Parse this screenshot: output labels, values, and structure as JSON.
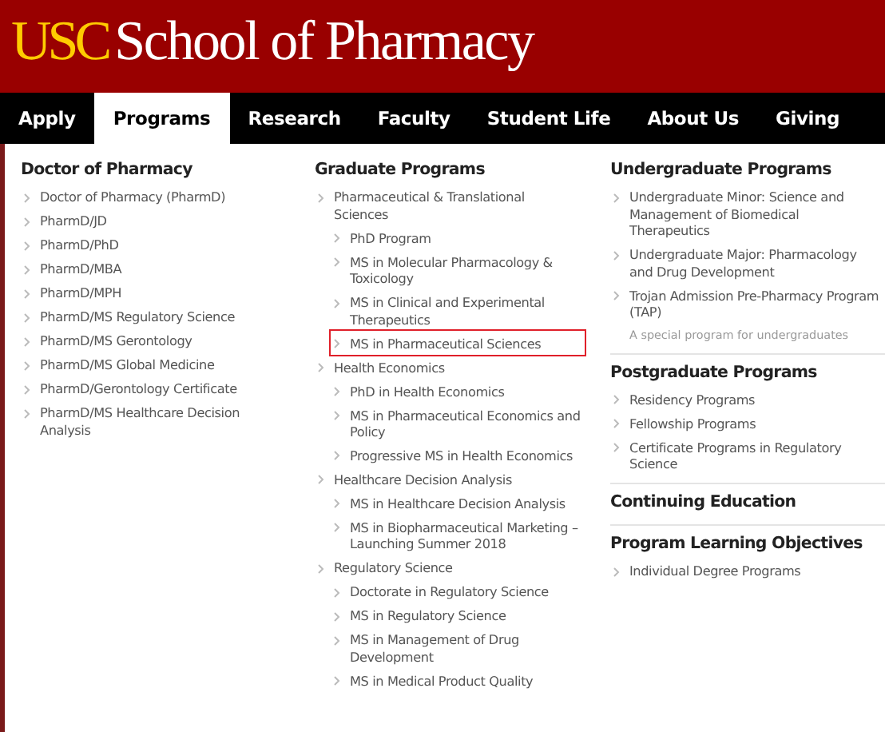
{
  "header": {
    "logo_mark": "USC",
    "title": "School of Pharmacy"
  },
  "nav": [
    {
      "label": "Apply",
      "selected": false
    },
    {
      "label": "Programs",
      "selected": true
    },
    {
      "label": "Research",
      "selected": false
    },
    {
      "label": "Faculty",
      "selected": false
    },
    {
      "label": "Student Life",
      "selected": false
    },
    {
      "label": "About Us",
      "selected": false
    },
    {
      "label": "Giving",
      "selected": false
    }
  ],
  "columns": [
    {
      "sections": [
        {
          "heading": "Doctor of Pharmacy",
          "items": [
            {
              "label": "Doctor of Pharmacy (PharmD)"
            },
            {
              "label": "PharmD/JD"
            },
            {
              "label": "PharmD/PhD"
            },
            {
              "label": "PharmD/MBA"
            },
            {
              "label": "PharmD/MPH"
            },
            {
              "label": "PharmD/MS Regulatory Science"
            },
            {
              "label": "PharmD/MS Gerontology"
            },
            {
              "label": "PharmD/MS Global Medicine"
            },
            {
              "label": "PharmD/Gerontology Certificate"
            },
            {
              "label": "PharmD/MS Healthcare Decision Analysis"
            }
          ]
        }
      ]
    },
    {
      "sections": [
        {
          "heading": "Graduate Programs",
          "items": [
            {
              "label": "Pharmaceutical & Translational Sciences",
              "children": [
                {
                  "label": "PhD Program",
                  "highlighted": false
                },
                {
                  "label": "MS in Molecular Pharmacology & Toxicology",
                  "highlighted": false
                },
                {
                  "label": "MS in Clinical and Experimental Therapeutics",
                  "highlighted": false
                },
                {
                  "label": "MS in Pharmaceutical Sciences",
                  "highlighted": true
                }
              ]
            },
            {
              "label": "Health Economics",
              "children": [
                {
                  "label": "PhD in Health Economics",
                  "highlighted": false
                },
                {
                  "label": "MS in Pharmaceutical Economics and Policy",
                  "highlighted": false
                },
                {
                  "label": "Progressive MS in Health Economics",
                  "highlighted": false
                }
              ]
            },
            {
              "label": "Healthcare Decision Analysis",
              "children": [
                {
                  "label": "MS in Healthcare Decision Analysis",
                  "highlighted": false
                },
                {
                  "label": "MS in Biopharmaceutical Marketing – Launching Summer 2018",
                  "highlighted": false
                }
              ]
            },
            {
              "label": "Regulatory Science",
              "children": [
                {
                  "label": "Doctorate in Regulatory Science",
                  "highlighted": false
                },
                {
                  "label": "MS in Regulatory Science",
                  "highlighted": false
                },
                {
                  "label": "MS in Management of Drug Development",
                  "highlighted": false
                },
                {
                  "label": "MS in Medical Product Quality",
                  "highlighted": false
                }
              ]
            }
          ]
        }
      ]
    },
    {
      "sections": [
        {
          "heading": "Undergraduate Programs",
          "items": [
            {
              "label": "Undergraduate Minor: Science and Management of Biomedical Therapeutics"
            },
            {
              "label": "Undergraduate Major: Pharmacology and Drug Development"
            },
            {
              "label": "Trojan Admission Pre-Pharmacy Program (TAP)"
            }
          ],
          "note": "A special program for undergraduates"
        },
        {
          "heading": "Postgraduate Programs",
          "items": [
            {
              "label": "Residency Programs"
            },
            {
              "label": "Fellowship Programs"
            },
            {
              "label": "Certificate Programs in Regulatory Science"
            }
          ]
        },
        {
          "heading": "Continuing Education"
        },
        {
          "heading": "Program Learning Objectives",
          "items": [
            {
              "label": "Individual Degree Programs"
            }
          ]
        }
      ]
    }
  ]
}
